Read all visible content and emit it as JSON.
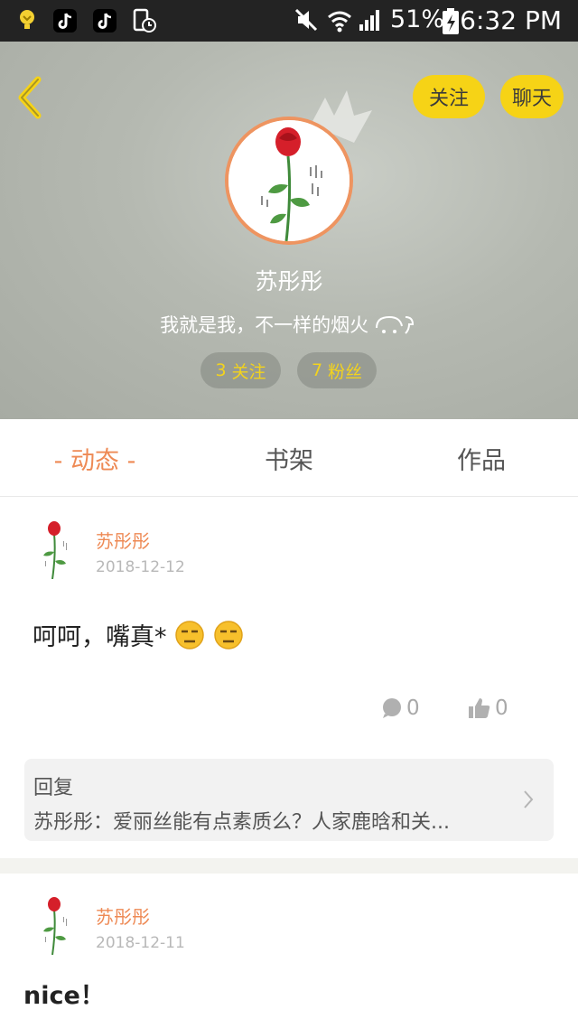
{
  "status_bar": {
    "battery_percent": "51%",
    "time": "6:32 PM"
  },
  "header": {
    "follow_label": "关注",
    "chat_label": "聊天",
    "name": "苏彤彤",
    "bio": "我就是我，不一样的烟火",
    "following_count": "3",
    "following_label": "关注",
    "fans_count": "7",
    "fans_label": "粉丝"
  },
  "tabs": [
    {
      "label": "- 动态 -",
      "active": true
    },
    {
      "label": "书架",
      "active": false
    },
    {
      "label": "作品",
      "active": false
    }
  ],
  "posts": [
    {
      "author": "苏彤彤",
      "date": "2018-12-12",
      "text": "呵呵，嘴真*",
      "comments": "0",
      "likes": "0",
      "reply": {
        "title": "回复",
        "content": "苏彤彤：爱丽丝能有点素质么？人家鹿晗和关..."
      }
    },
    {
      "author": "苏彤彤",
      "date": "2018-12-11",
      "text": "nice！"
    }
  ],
  "colors": {
    "accent": "#ee8a55",
    "button_yellow": "#f6d316",
    "statusbar": "#232323"
  }
}
